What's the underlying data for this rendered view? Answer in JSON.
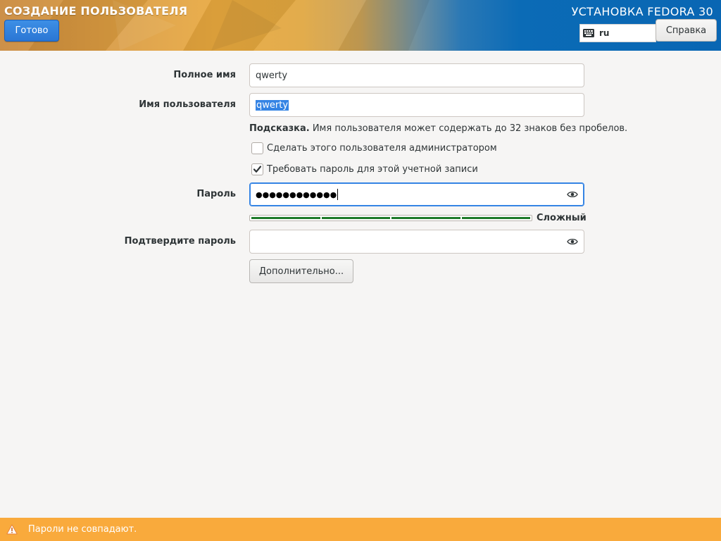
{
  "header": {
    "title": "СОЗДАНИЕ ПОЛЬЗОВАТЕЛЯ",
    "done_label": "Готово",
    "product_title": "УСТАНОВКА FEDORA 30",
    "keyboard_layout": "ru",
    "help_label": "Справка",
    "colors": {
      "accent": "#2a76d4",
      "banner_blue": "#0966b3",
      "banner_orange": "#e8a83e"
    }
  },
  "form": {
    "full_name": {
      "label": "Полное имя",
      "value": "qwerty"
    },
    "username": {
      "label": "Имя пользователя",
      "value": "qwerty"
    },
    "hint": {
      "prefix": "Подсказка.",
      "text": " Имя пользователя может содержать до 32 знаков без пробелов."
    },
    "admin_checkbox": {
      "label": "Сделать этого пользователя администратором",
      "checked": false
    },
    "require_password_checkbox": {
      "label": "Требовать пароль для этой учетной записи",
      "checked": true
    },
    "password": {
      "label": "Пароль",
      "masked_value": "●●●●●●●●●●●●"
    },
    "strength": {
      "label": "Сложный",
      "level": 1.0,
      "color": "#1e7a2a"
    },
    "confirm_password": {
      "label": "Подтвердите пароль",
      "value": ""
    },
    "advanced_label": "Дополнительно..."
  },
  "status": {
    "message": "Пароли не совпадают.",
    "color": "#f9aa3c",
    "icon": "warning-icon"
  }
}
